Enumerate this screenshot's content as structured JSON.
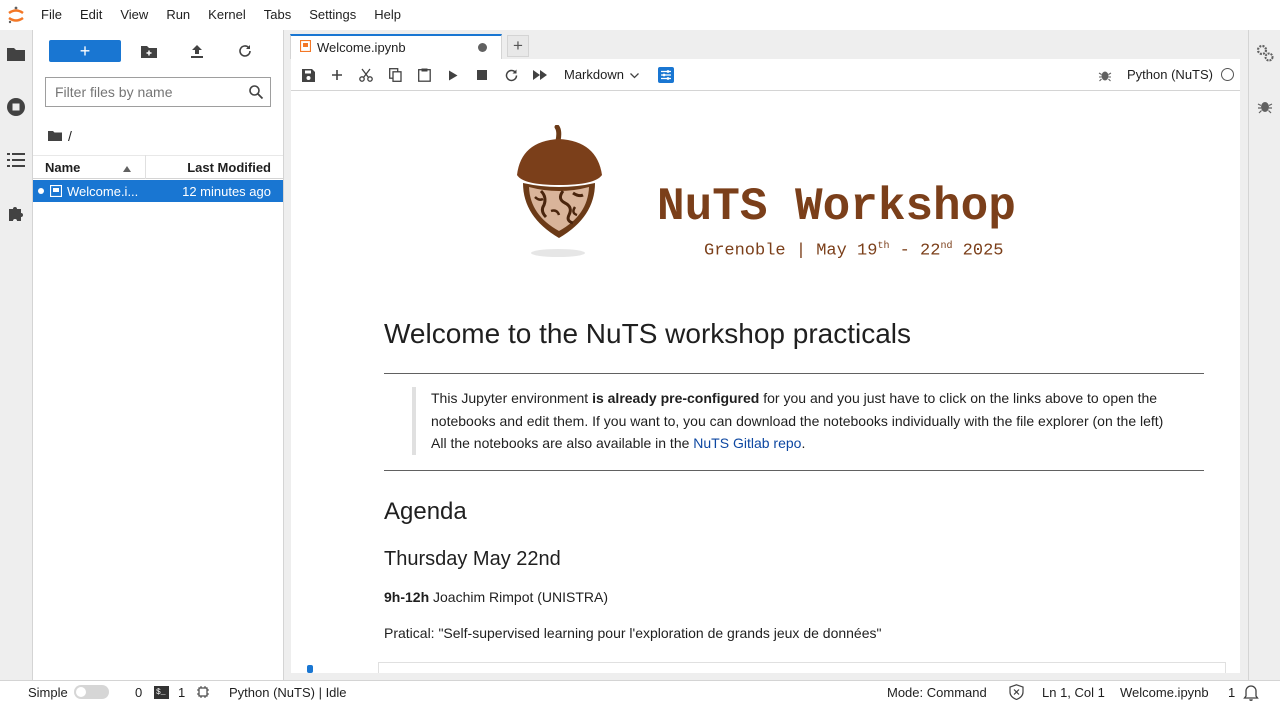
{
  "menu": {
    "items": [
      "File",
      "Edit",
      "View",
      "Run",
      "Kernel",
      "Tabs",
      "Settings",
      "Help"
    ]
  },
  "filebrowser": {
    "new_label": "+",
    "filter_placeholder": "Filter files by name",
    "breadcrumb": "/",
    "columns": {
      "name": "Name",
      "modified": "Last Modified"
    },
    "files": [
      {
        "name": "Welcome.i...",
        "modified": "12 minutes ago",
        "selected": true
      }
    ]
  },
  "tabs": [
    {
      "label": "Welcome.ipynb",
      "modified": true
    }
  ],
  "toolbar": {
    "cell_type": "Markdown",
    "kernel": "Python (NuTS)"
  },
  "notebook": {
    "banner_title": "NuTS Workshop",
    "banner_sub_prefix": "Grenoble | May 19",
    "banner_sup1": "th",
    "banner_sub_mid": " - 22",
    "banner_sup2": "nd",
    "banner_sub_suffix": " 2025",
    "heading": "Welcome to the NuTS workshop practicals",
    "quote_part1": "This Jupyter environment ",
    "quote_bold": "is already pre-configured",
    "quote_part2": " for you and you just have to click on the links above to open the notebooks and edit them. If you want to, you can download the notebooks individually with the file explorer (on the left) All the notebooks are also available in the ",
    "quote_link": "NuTS Gitlab repo",
    "quote_end": ".",
    "agenda": "Agenda",
    "day": "Thursday May 22nd",
    "slot_time": "9h-12h",
    "slot_speaker": " Joachim Rimpot (UNISTRA)",
    "talk": "Pratical: \"Self-supervised learning pour l'exploration de grands jeux de données\""
  },
  "status": {
    "mode_label": "Simple",
    "terminals": "0",
    "kernels": "1",
    "kernel_status": "Python (NuTS) | Idle",
    "command_mode": "Mode: Command",
    "cursor": "Ln 1, Col 1",
    "filename": "Welcome.ipynb",
    "notifications": "1"
  },
  "colors": {
    "accent": "#1976d2",
    "brand_brown": "#7b3f1a",
    "link": "#0d47a1"
  }
}
